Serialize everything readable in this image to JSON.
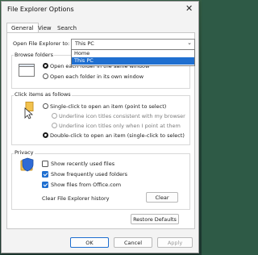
{
  "window": {
    "title": "File Explorer Options",
    "close_glyph": "✕"
  },
  "tabs": [
    {
      "label": "General"
    },
    {
      "label": "View"
    },
    {
      "label": "Search"
    }
  ],
  "open_to": {
    "label": "Open File Explorer to:",
    "value": "This PC",
    "options": [
      "Home",
      "This PC"
    ],
    "selected": "This PC"
  },
  "browse_folders": {
    "title": "Browse folders",
    "option1": "Open each folder in the same window",
    "option2": "Open each folder in its own window"
  },
  "click_items": {
    "title": "Click items as follows",
    "single": "Single-click to open an item (point to select)",
    "underline_browser": "Underline icon titles consistent with my browser",
    "underline_point": "Underline icon titles only when I point at them",
    "double": "Double-click to open an item (single-click to select)"
  },
  "privacy": {
    "title": "Privacy",
    "recent": "Show recently used files",
    "frequent": "Show frequently used folders",
    "office": "Show files from Office.com",
    "clear_label": "Clear File Explorer history",
    "clear_button": "Clear"
  },
  "restore_defaults": "Restore Defaults",
  "footer": {
    "ok": "OK",
    "cancel": "Cancel",
    "apply": "Apply"
  },
  "colors": {
    "accent": "#1f6fd0",
    "folder": "#f2c24e"
  }
}
